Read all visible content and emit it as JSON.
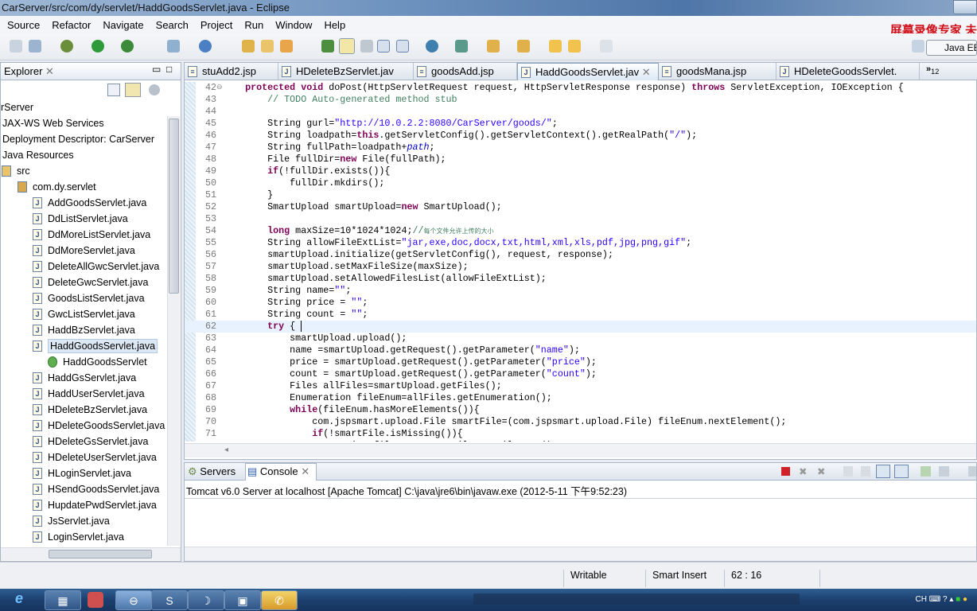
{
  "window": {
    "title": "CarServer/src/com/dy/servlet/HaddGoodsServlet.java - Eclipse"
  },
  "menu": [
    "Source",
    "Refactor",
    "Navigate",
    "Search",
    "Project",
    "Run",
    "Window",
    "Help"
  ],
  "watermark": "屏幕录像专家 未",
  "perspective": "Java EE",
  "explorer": {
    "title": "Explorer",
    "items": [
      {
        "label": "rServer",
        "level": 0,
        "icon": "project-icon"
      },
      {
        "label": "JAX-WS Web Services",
        "level": 0,
        "icon": "none"
      },
      {
        "label": "Deployment Descriptor: CarServer",
        "level": 0,
        "icon": "none"
      },
      {
        "label": "Java Resources",
        "level": 0,
        "icon": "none"
      },
      {
        "label": "src",
        "level": 1,
        "icon": "source-folder-icon"
      },
      {
        "label": "com.dy.servlet",
        "level": 2,
        "icon": "package-icon"
      },
      {
        "label": "AddGoodsServlet.java",
        "level": 3,
        "icon": "java-file-icon"
      },
      {
        "label": "DdListServlet.java",
        "level": 3,
        "icon": "java-file-icon"
      },
      {
        "label": "DdMoreListServlet.java",
        "level": 3,
        "icon": "java-file-icon"
      },
      {
        "label": "DdMoreServlet.java",
        "level": 3,
        "icon": "java-file-icon"
      },
      {
        "label": "DeleteAllGwcServlet.java",
        "level": 3,
        "icon": "java-file-icon"
      },
      {
        "label": "DeleteGwcServlet.java",
        "level": 3,
        "icon": "java-file-icon"
      },
      {
        "label": "GoodsListServlet.java",
        "level": 3,
        "icon": "java-file-icon"
      },
      {
        "label": "GwcListServlet.java",
        "level": 3,
        "icon": "java-file-icon"
      },
      {
        "label": "HaddBzServlet.java",
        "level": 3,
        "icon": "java-file-icon"
      },
      {
        "label": "HaddGoodsServlet.java",
        "level": 3,
        "icon": "java-file-icon",
        "selected": true
      },
      {
        "label": "HaddGoodsServlet",
        "level": 4,
        "icon": "class-icon"
      },
      {
        "label": "HaddGsServlet.java",
        "level": 3,
        "icon": "java-file-icon"
      },
      {
        "label": "HaddUserServlet.java",
        "level": 3,
        "icon": "java-file-icon"
      },
      {
        "label": "HDeleteBzServlet.java",
        "level": 3,
        "icon": "java-file-icon"
      },
      {
        "label": "HDeleteGoodsServlet.java",
        "level": 3,
        "icon": "java-file-icon"
      },
      {
        "label": "HDeleteGsServlet.java",
        "level": 3,
        "icon": "java-file-icon"
      },
      {
        "label": "HDeleteUserServlet.java",
        "level": 3,
        "icon": "java-file-icon"
      },
      {
        "label": "HLoginServlet.java",
        "level": 3,
        "icon": "java-file-icon"
      },
      {
        "label": "HSendGoodsServlet.java",
        "level": 3,
        "icon": "java-file-icon"
      },
      {
        "label": "HupdatePwdServlet.java",
        "level": 3,
        "icon": "java-file-icon"
      },
      {
        "label": "JsServlet.java",
        "level": 3,
        "icon": "java-file-icon"
      },
      {
        "label": "LoginServlet.java",
        "level": 3,
        "icon": "java-file-icon"
      }
    ]
  },
  "editor": {
    "tabs": [
      {
        "label": "stuAdd2.jsp",
        "icon": "jsp-file-icon"
      },
      {
        "label": "HDeleteBzServlet.jav",
        "icon": "java-file-icon"
      },
      {
        "label": "goodsAdd.jsp",
        "icon": "jsp-file-icon"
      },
      {
        "label": "HaddGoodsServlet.jav",
        "icon": "java-file-icon",
        "active": true
      },
      {
        "label": "goodsMana.jsp",
        "icon": "jsp-file-icon"
      },
      {
        "label": "HDeleteGoodsServlet.",
        "icon": "java-file-icon"
      }
    ],
    "overflow_count": "12",
    "current_line": 62,
    "lines": [
      {
        "n": "42",
        "t": [
          [
            "n",
            "    "
          ],
          [
            "k",
            "protected void"
          ],
          [
            "n",
            " doPost(HttpServletRequest request, HttpServletResponse response) "
          ],
          [
            "k",
            "throws"
          ],
          [
            "n",
            " ServletException, IOException {"
          ]
        ]
      },
      {
        "n": "43",
        "t": [
          [
            "n",
            "        "
          ],
          [
            "c",
            "// TODO Auto-generated method stub"
          ]
        ]
      },
      {
        "n": "44",
        "t": []
      },
      {
        "n": "45",
        "t": [
          [
            "n",
            "        String gurl="
          ],
          [
            "s",
            "\"http://10.0.2.2:8080/CarServer/goods/\""
          ],
          [
            "n",
            ";"
          ]
        ]
      },
      {
        "n": "46",
        "t": [
          [
            "n",
            "        String loadpath="
          ],
          [
            "k",
            "this"
          ],
          [
            "n",
            ".getServletConfig().getServletContext().getRealPath("
          ],
          [
            "s",
            "\"/\""
          ],
          [
            "n",
            ");"
          ]
        ]
      },
      {
        "n": "47",
        "t": [
          [
            "n",
            "        String fullPath=loadpath+"
          ],
          [
            "i",
            "path"
          ],
          [
            "n",
            ";"
          ]
        ]
      },
      {
        "n": "48",
        "t": [
          [
            "n",
            "        File fullDir="
          ],
          [
            "k",
            "new"
          ],
          [
            "n",
            " File(fullPath);"
          ]
        ]
      },
      {
        "n": "49",
        "t": [
          [
            "n",
            "        "
          ],
          [
            "k",
            "if"
          ],
          [
            "n",
            "(!fullDir.exists()){"
          ]
        ]
      },
      {
        "n": "50",
        "t": [
          [
            "n",
            "            fullDir.mkdirs();"
          ]
        ]
      },
      {
        "n": "51",
        "t": [
          [
            "n",
            "        }"
          ]
        ]
      },
      {
        "n": "52",
        "t": [
          [
            "n",
            "        SmartUpload smartUpload="
          ],
          [
            "k",
            "new"
          ],
          [
            "n",
            " SmartUpload();"
          ]
        ]
      },
      {
        "n": "53",
        "t": []
      },
      {
        "n": "54",
        "t": [
          [
            "n",
            "        "
          ],
          [
            "k",
            "long"
          ],
          [
            "n",
            " maxSize=10*1024*1024;"
          ],
          [
            "c",
            "//"
          ],
          [
            "cz",
            "每个文件允许上传的大小"
          ]
        ]
      },
      {
        "n": "55",
        "t": [
          [
            "n",
            "        String allowFileExtList="
          ],
          [
            "s",
            "\"jar,exe,doc,docx,txt,html,xml,xls,pdf,jpg,png,gif\""
          ],
          [
            "n",
            ";"
          ]
        ]
      },
      {
        "n": "56",
        "t": [
          [
            "n",
            "        smartUpload.initialize(getServletConfig(), request, response);"
          ]
        ]
      },
      {
        "n": "57",
        "t": [
          [
            "n",
            "        smartUpload.setMaxFileSize(maxSize);"
          ]
        ]
      },
      {
        "n": "58",
        "t": [
          [
            "n",
            "        smartUpload.setAllowedFilesList(allowFileExtList);"
          ]
        ]
      },
      {
        "n": "59",
        "t": [
          [
            "n",
            "        String name="
          ],
          [
            "s",
            "\"\""
          ],
          [
            "n",
            ";"
          ]
        ]
      },
      {
        "n": "60",
        "t": [
          [
            "n",
            "        String price = "
          ],
          [
            "s",
            "\"\""
          ],
          [
            "n",
            ";"
          ]
        ]
      },
      {
        "n": "61",
        "t": [
          [
            "n",
            "        String count = "
          ],
          [
            "s",
            "\"\""
          ],
          [
            "n",
            ";"
          ]
        ]
      },
      {
        "n": "62",
        "t": [
          [
            "n",
            "        "
          ],
          [
            "k",
            "try"
          ],
          [
            "n",
            " { "
          ]
        ]
      },
      {
        "n": "63",
        "t": [
          [
            "n",
            "            smartUpload.upload();"
          ]
        ]
      },
      {
        "n": "64",
        "t": [
          [
            "n",
            "            name =smartUpload.getRequest().getParameter("
          ],
          [
            "s",
            "\"name\""
          ],
          [
            "n",
            ");"
          ]
        ]
      },
      {
        "n": "65",
        "t": [
          [
            "n",
            "            price = smartUpload.getRequest().getParameter("
          ],
          [
            "s",
            "\"price\""
          ],
          [
            "n",
            ");"
          ]
        ]
      },
      {
        "n": "66",
        "t": [
          [
            "n",
            "            count = smartUpload.getRequest().getParameter("
          ],
          [
            "s",
            "\"count\""
          ],
          [
            "n",
            ");"
          ]
        ]
      },
      {
        "n": "67",
        "t": [
          [
            "n",
            "            Files allFiles=smartUpload.getFiles();"
          ]
        ]
      },
      {
        "n": "68",
        "t": [
          [
            "n",
            "            Enumeration fileEnum=allFiles.getEnumeration();"
          ]
        ]
      },
      {
        "n": "69",
        "t": [
          [
            "n",
            "            "
          ],
          [
            "k",
            "while"
          ],
          [
            "n",
            "(fileEnum.hasMoreElements()){"
          ]
        ]
      },
      {
        "n": "70",
        "t": [
          [
            "n",
            "                com.jspsmart.upload.File smartFile=(com.jspsmart.upload.File) fileEnum.nextElement();"
          ]
        ]
      },
      {
        "n": "71",
        "t": [
          [
            "n",
            "                "
          ],
          [
            "k",
            "if"
          ],
          [
            "n",
            "(!smartFile.isMissing()){"
          ]
        ]
      },
      {
        "n": "72",
        "t": [
          [
            "n",
            "                    String fileName=smartFile.getFileName();"
          ]
        ]
      }
    ]
  },
  "console": {
    "tabs": [
      "Servers",
      "Console"
    ],
    "header": "Tomcat v6.0 Server at localhost [Apache Tomcat] C:\\java\\jre6\\bin\\javaw.exe (2012-5-11 下午9:52:23)"
  },
  "status": {
    "mode": "Writable",
    "insert": "Smart Insert",
    "position": "62 : 16"
  },
  "taskbar": {
    "apps": [
      "internet-explorer-icon",
      "file-manager-icon",
      "app-icon",
      "eclipse-icon",
      "sogou-icon",
      "app-icon",
      "calculator-icon",
      "phone-icon"
    ],
    "tray_lang": "CH"
  },
  "colors": {
    "keyword": "#7f0055",
    "string": "#2a00ff",
    "comment": "#3f7f5f",
    "field": "#0000c0",
    "current_line": "#e8f2fe",
    "watermark": "#d0101a"
  }
}
